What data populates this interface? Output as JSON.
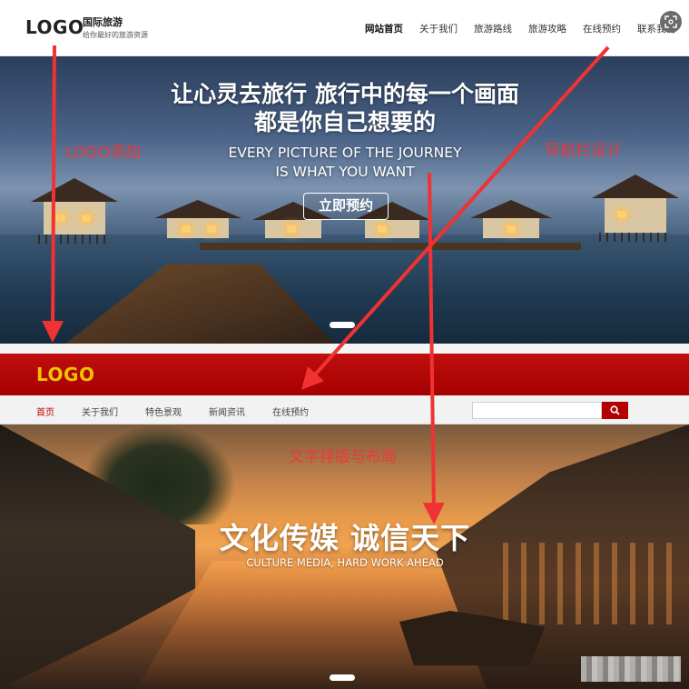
{
  "site1": {
    "logo": "LOGO",
    "brand_name": "国际旅游",
    "brand_tagline": "给你最好的旅游资源",
    "nav": [
      "网站首页",
      "关于我们",
      "旅游路线",
      "旅游攻略",
      "在线预约",
      "联系我们"
    ]
  },
  "hero1": {
    "title_line1": "让心灵去旅行 旅行中的每一个画面",
    "title_line2": "都是你自己想要的",
    "subtitle_line1": "EVERY PICTURE OF THE JOURNEY",
    "subtitle_line2": "IS WHAT YOU WANT",
    "button_label": "立即预约"
  },
  "annotations": {
    "logo_add": "LOGO添加",
    "nav_design": "导航栏设计",
    "text_layout": "文字排版与布局"
  },
  "site2": {
    "logo": "LOGO",
    "nav": [
      "首页",
      "关于我们",
      "特色景观",
      "新闻资讯",
      "在线预约"
    ],
    "search_placeholder": ""
  },
  "hero2": {
    "title": "文化传媒 诚信天下",
    "subtitle": "CULTURE MEDIA, HARD WORK AHEAD"
  },
  "colors": {
    "annotation_red": "#ea3a3a",
    "header2_red": "#b30000",
    "logo2_gold": "#f2c200",
    "nav2_active": "#c00000"
  },
  "icons": [
    "expand-icon",
    "search-icon",
    "arrow-icon"
  ]
}
